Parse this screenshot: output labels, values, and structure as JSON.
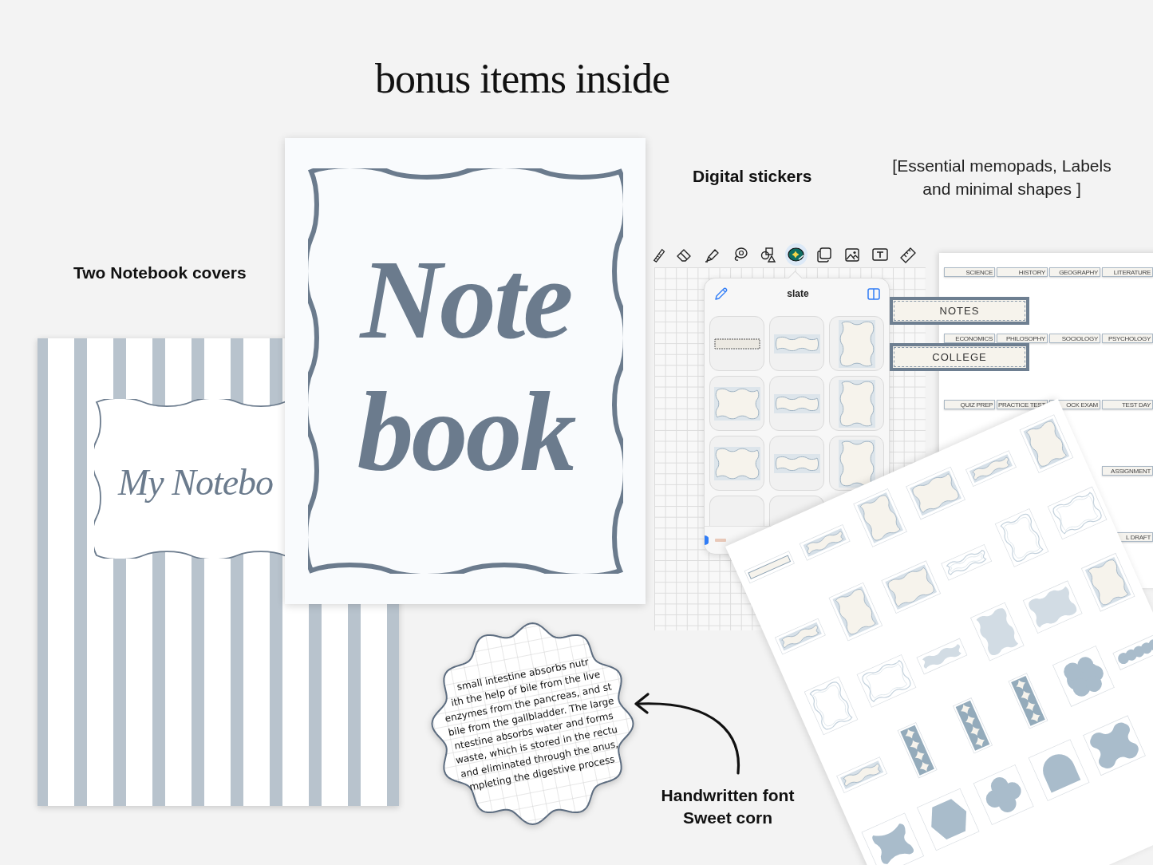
{
  "title": "bonus items inside",
  "notebook_covers": {
    "caption": "Two Notebook covers",
    "striped_cover": {
      "title": "My Notebo"
    },
    "plain_cover": {
      "title_lines": [
        "Note",
        "book"
      ]
    }
  },
  "digital_stickers": {
    "caption": "Digital stickers",
    "description_lines": [
      "[Essential memopads, Labels",
      "and minimal shapes ]"
    ],
    "app": {
      "tools": [
        {
          "selected": false
        },
        {
          "selected": false
        },
        {
          "selected": false
        },
        {
          "selected": false
        },
        {
          "selected": false
        },
        {
          "selected": true
        },
        {
          "selected": false
        },
        {
          "selected": false
        },
        {
          "selected": false
        },
        {
          "selected": false
        }
      ],
      "panel": {
        "title": "slate"
      }
    },
    "label_sheet": {
      "rows": [
        [
          "SCIENCE",
          "HISTORY",
          "GEOGRAPHY",
          "LITERATURE"
        ],
        [
          "ECONOMICS",
          "PHILOSOPHY",
          "SOCIOLOGY",
          "PSYCHOLOGY"
        ],
        [
          "QUIZ PREP",
          "PRACTICE TEST",
          "OCK EXAM",
          "TEST DAY"
        ],
        [
          "ASSIGNMENT"
        ],
        [
          "L DRAFT"
        ]
      ],
      "featured_labels": [
        "NOTES",
        "COLLEGE"
      ]
    }
  },
  "handwritten_font": {
    "caption_lines": [
      "Handwritten font",
      "Sweet corn"
    ],
    "sample_lines": [
      "small intestine absorbs nutr",
      "ith the help of bile from the live",
      "enzymes from the pancreas, and st",
      "bile from the gallbladder. The large",
      "ntestine absorbs water and forms",
      "waste, which is stored in the rectu",
      "and eliminated through the anus,",
      "mpleting the digestive process"
    ]
  }
}
